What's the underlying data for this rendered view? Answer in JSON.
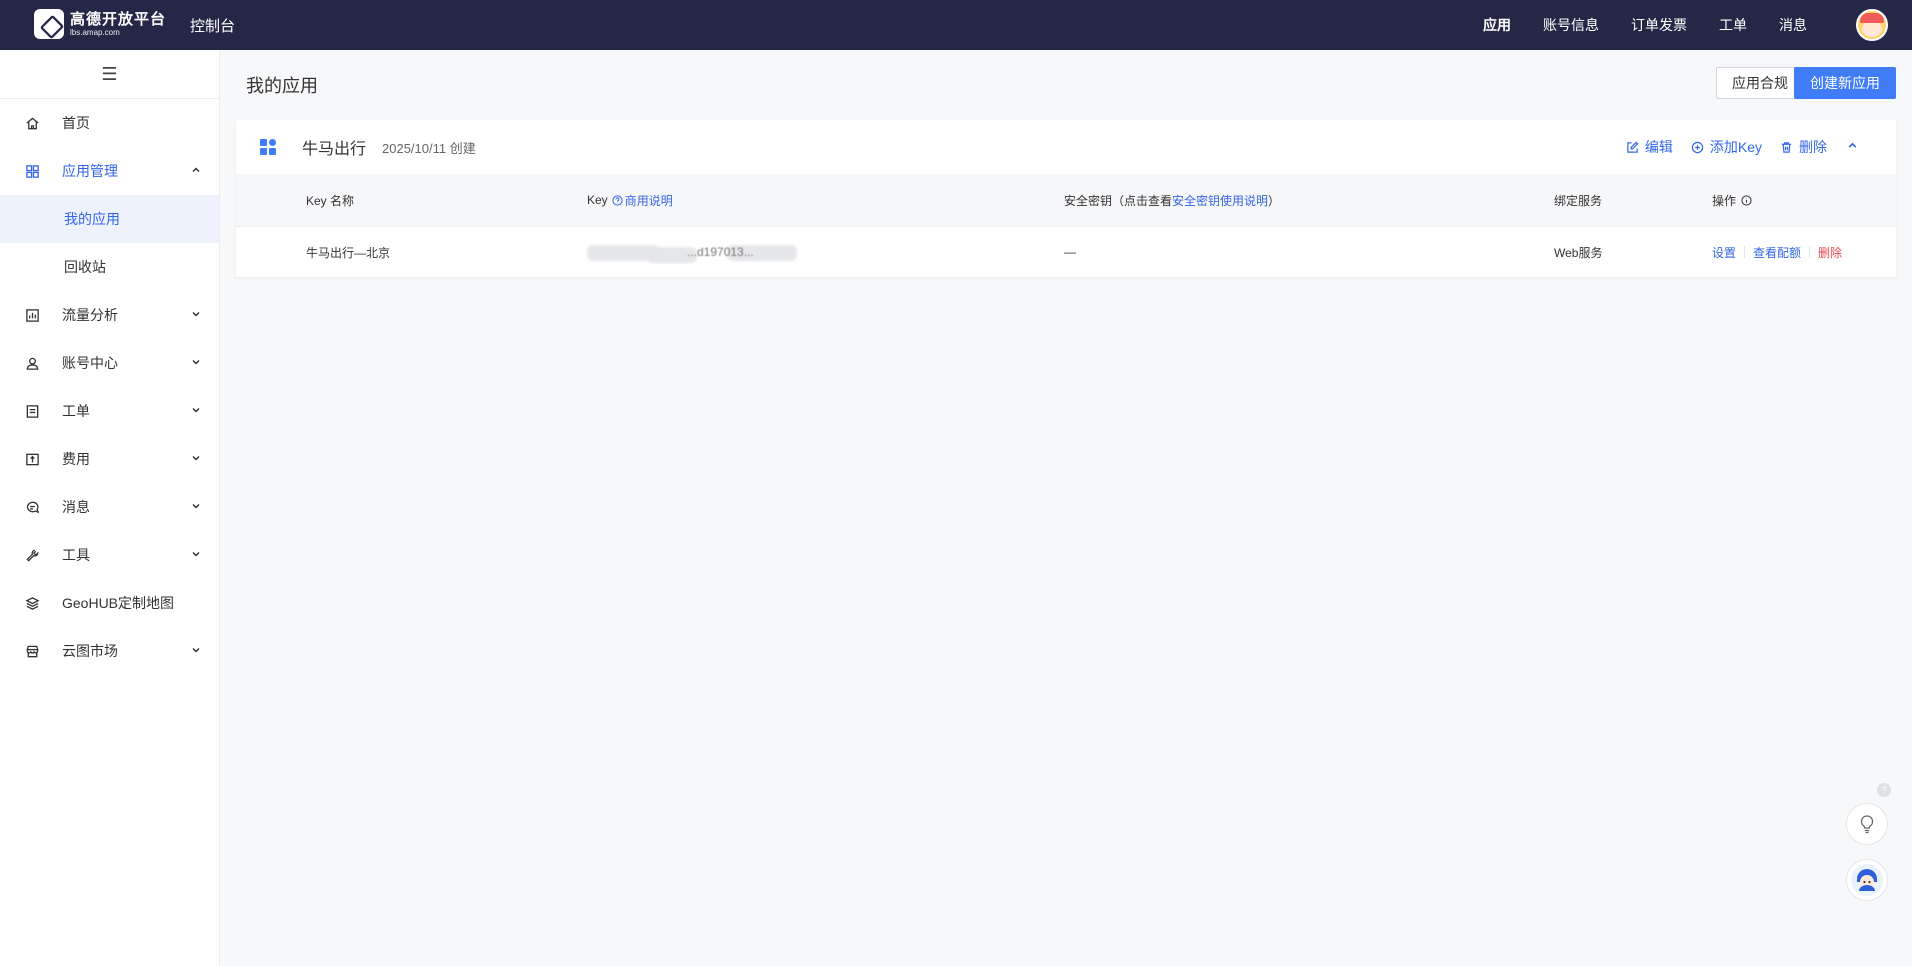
{
  "header": {
    "logo_title": "高德开放平台",
    "logo_subtitle": "lbs.amap.com",
    "console": "控制台",
    "nav": [
      "应用",
      "账号信息",
      "订单发票",
      "工单",
      "消息"
    ],
    "active_nav": "应用"
  },
  "sidebar": {
    "toggle": "☰",
    "items": [
      {
        "label": "首页",
        "icon": "home-icon"
      },
      {
        "label": "应用管理",
        "icon": "apps-grid-icon",
        "open": true
      },
      {
        "label": "流量分析",
        "icon": "chart-icon"
      },
      {
        "label": "账号中心",
        "icon": "user-icon"
      },
      {
        "label": "工单",
        "icon": "ticket-icon"
      },
      {
        "label": "费用",
        "icon": "billing-icon"
      },
      {
        "label": "消息",
        "icon": "message-icon"
      },
      {
        "label": "工具",
        "icon": "wrench-icon"
      },
      {
        "label": "GeoHUB定制地图",
        "icon": "layers-icon"
      },
      {
        "label": "云图市场",
        "icon": "store-icon"
      }
    ],
    "sub_items": [
      "我的应用",
      "回收站"
    ],
    "active_sub": "我的应用"
  },
  "main": {
    "title": "我的应用",
    "compliance_button": "应用合规",
    "create_button": "创建新应用"
  },
  "app_card": {
    "name": "牛马出行",
    "created": "2025/10/11 创建",
    "actions": {
      "edit": "编辑",
      "add_key": "添加Key",
      "delete": "删除"
    },
    "table": {
      "headers": {
        "key_name": "Key 名称",
        "key": "Key",
        "key_help": "商用说明",
        "secret_prefix": "安全密钥（点击查看",
        "secret_link": "安全密钥使用说明",
        "secret_suffix": "）",
        "service": "绑定服务",
        "ops": "操作"
      },
      "rows": [
        {
          "key_name": "牛马出行—北京",
          "key_partial": "...d197013...",
          "secret": "—",
          "service": "Web服务",
          "ops": {
            "settings": "设置",
            "quota": "查看配额",
            "delete": "删除"
          }
        }
      ]
    }
  },
  "floating": {
    "badge": "?"
  }
}
